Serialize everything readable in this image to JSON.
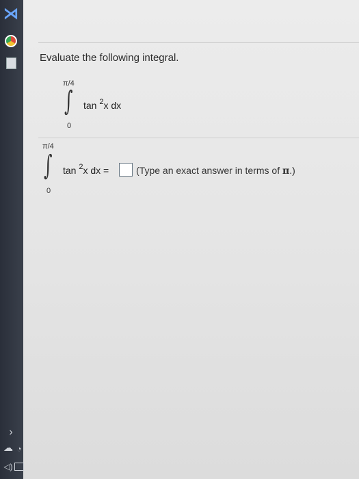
{
  "question": {
    "prompt": "Evaluate the following integral.",
    "problem": {
      "upper_limit": "π/4",
      "lower_limit": "0",
      "integrand_func": "tan",
      "exponent": "2",
      "integrand_var": "x dx"
    },
    "answer_row": {
      "upper_limit": "π/4",
      "lower_limit": "0",
      "integrand_func": "tan",
      "exponent": "2",
      "integrand_tail": "x dx =",
      "answer_value": "",
      "instruction_open": "(Type an exact answer in terms of ",
      "pi_symbol": "π",
      "instruction_close": ".)"
    }
  },
  "taskbar": {
    "icons": [
      "visual-studio-icon",
      "chrome-icon",
      "calculator-icon",
      "chevron-up-icon",
      "onedrive-icon",
      "wifi-icon",
      "volume-icon",
      "keyboard-icon"
    ]
  }
}
